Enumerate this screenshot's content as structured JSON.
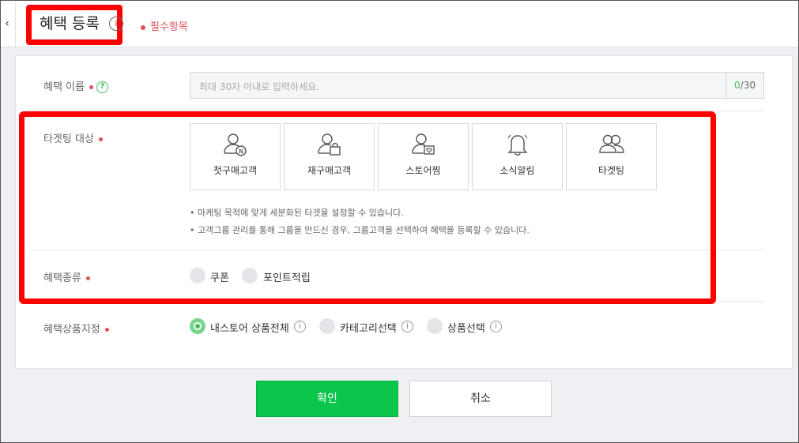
{
  "header": {
    "back_label": "‹",
    "title": "혜택 등록",
    "title_info": "i",
    "required_note": "필수항목"
  },
  "name_row": {
    "label": "혜택 이름",
    "help": "?",
    "placeholder": "최대 30자 이내로 입력하세요.",
    "counter_current": "0",
    "counter_max": "/30"
  },
  "targeting": {
    "label": "타겟팅 대상",
    "cards": [
      {
        "label": "첫구매고객",
        "icon": "user-n-icon"
      },
      {
        "label": "재구매고객",
        "icon": "user-bag-icon"
      },
      {
        "label": "스토어찜",
        "icon": "user-heart-icon"
      },
      {
        "label": "소식알림",
        "icon": "bell-icon"
      },
      {
        "label": "타겟팅",
        "icon": "users-icon"
      }
    ],
    "notes": [
      "• 마케팅 목적에 맞게 세분화된 타겟을 설정할 수 있습니다.",
      "• 고객그룹 관리를 통해 그룹을 만드신 경우, 그룹고객을 선택하여 혜택을 등록할 수 있습니다."
    ]
  },
  "benefit_type": {
    "label": "혜택종류",
    "options": [
      "쿠폰",
      "포인트적립"
    ]
  },
  "product_scope": {
    "label": "혜택상품지정",
    "options": [
      "내스토어 상품전체",
      "카테고리선택",
      "상품선택"
    ],
    "selected": "내스토어 상품전체",
    "info": "i"
  },
  "actions": {
    "confirm": "확인",
    "cancel": "취소"
  },
  "colors": {
    "accent": "#0bc64a",
    "required": "#e0505a",
    "highlight": "#ff0000"
  }
}
